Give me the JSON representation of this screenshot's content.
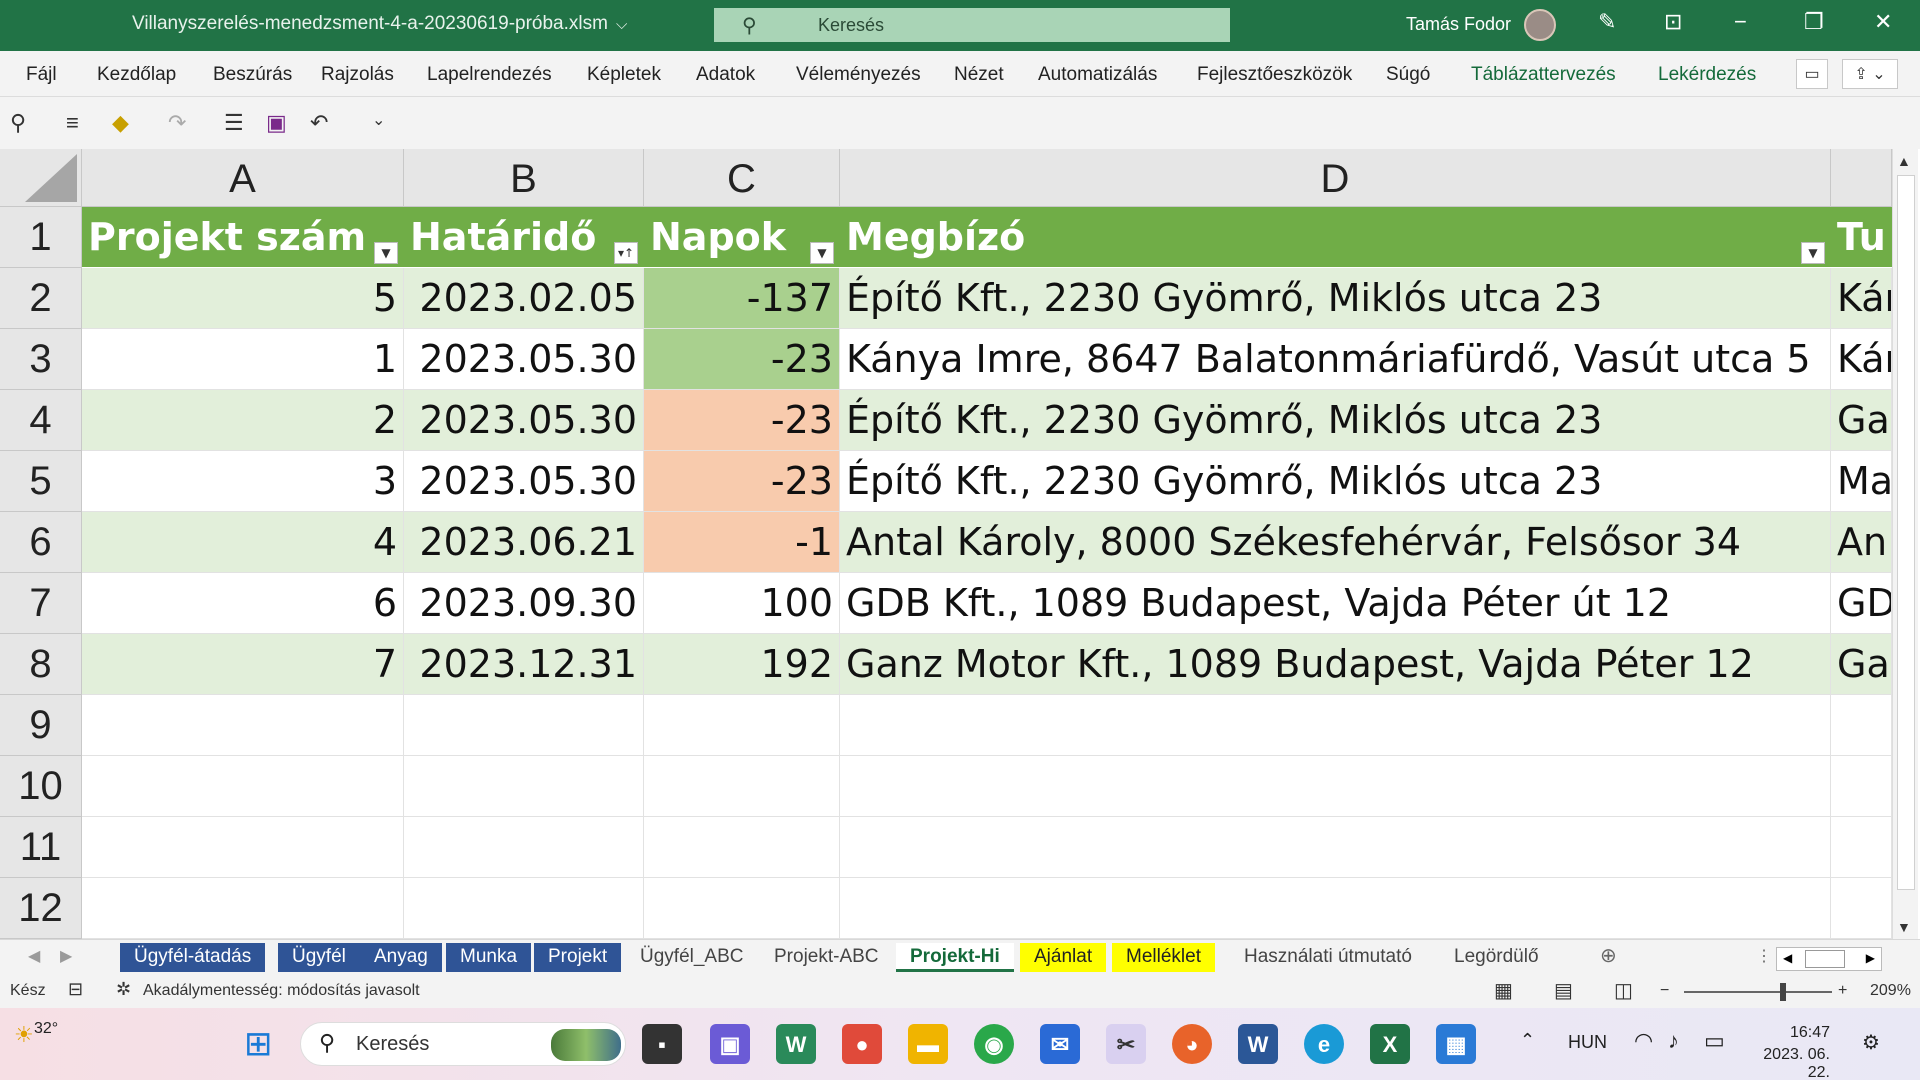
{
  "window": {
    "filename": "Villanyszerelés-menedzsment-4-a-20230619-próba.xlsm",
    "search_placeholder": "Keresés",
    "user": "Tamás Fodor"
  },
  "ribbon": {
    "tabs": [
      "Fájl",
      "Kezdőlap",
      "Beszúrás",
      "Rajzolás",
      "Lapelrendezés",
      "Képletek",
      "Adatok",
      "Véleményezés",
      "Nézet",
      "Automatizálás",
      "Fejlesztőeszközök",
      "Súgó",
      "Táblázattervezés",
      "Lekérdezés"
    ]
  },
  "grid": {
    "columns": [
      "A",
      "B",
      "C",
      "D"
    ],
    "rows": [
      "1",
      "2",
      "3",
      "4",
      "5",
      "6",
      "7",
      "8",
      "9",
      "10",
      "11",
      "12"
    ],
    "headers": {
      "a": "Projekt szám",
      "b": "Határidő",
      "c": "Napok",
      "d": "Megbízó",
      "e": "Tu"
    },
    "data": [
      {
        "a": "5",
        "b": "2023.02.05",
        "c": "-137",
        "d": "Építő Kft., 2230 Gyömrő, Miklós utca 23",
        "e": "Kár"
      },
      {
        "a": "1",
        "b": "2023.05.30",
        "c": "-23",
        "d": "Kánya Imre, 8647 Balatonmáriafürdő, Vasút utca 5",
        "e": "Kár"
      },
      {
        "a": "2",
        "b": "2023.05.30",
        "c": "-23",
        "d": "Építő Kft., 2230 Gyömrő, Miklós utca 23",
        "e": "Ga"
      },
      {
        "a": "3",
        "b": "2023.05.30",
        "c": "-23",
        "d": "Építő Kft., 2230 Gyömrő, Miklós utca 23",
        "e": "Ma"
      },
      {
        "a": "4",
        "b": "2023.06.21",
        "c": "-1",
        "d": "Antal Károly, 8000 Székesfehérvár, Felsősor 34",
        "e": "An"
      },
      {
        "a": "6",
        "b": "2023.09.30",
        "c": "100",
        "d": "GDB Kft., 1089 Budapest, Vajda Péter út 12",
        "e": "GD"
      },
      {
        "a": "7",
        "b": "2023.12.31",
        "c": "192",
        "d": "Ganz Motor Kft., 1089 Budapest, Vajda Péter 12",
        "e": "Ga"
      }
    ]
  },
  "sheets": [
    "Ügyfél-átadás",
    "Ügyfél",
    "Anyag",
    "Munka",
    "Projekt",
    "Ügyfél_ABC",
    "Projekt-ABC",
    "Projekt-Hi",
    "Ajánlat",
    "Melléklet",
    "Használati útmutató",
    "Legördülő"
  ],
  "status": {
    "ready": "Kész",
    "accessibility": "Akadálymentesség: módosítás javasolt",
    "zoom": "209%"
  },
  "taskbar": {
    "weather": "32°",
    "search": "Keresés",
    "lang": "HUN",
    "time": "16:47",
    "date": "2023. 06. 22."
  },
  "colors": {
    "excel_green": "#217346",
    "table_header": "#70ad47",
    "row_band": "#e2efda",
    "cf_green": "#a9d08e",
    "cf_orange": "#f8cbad",
    "sheet_blue": "#2f5496",
    "sheet_yellow": "#ffff00"
  }
}
